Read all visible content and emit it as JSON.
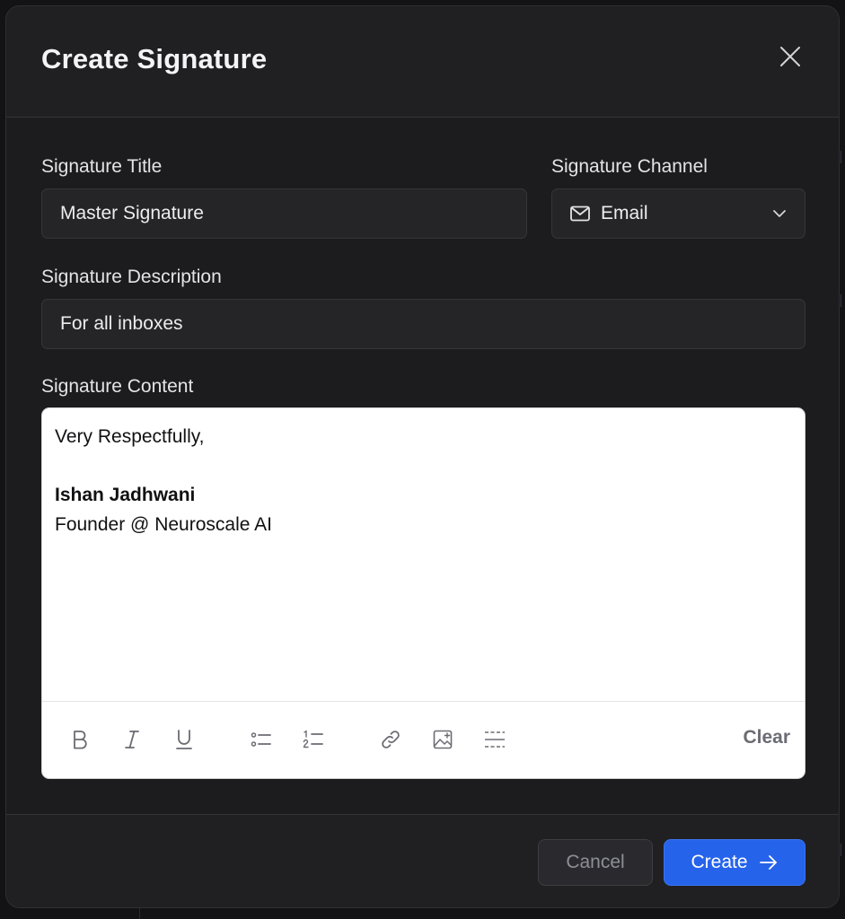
{
  "dialog": {
    "title": "Create Signature"
  },
  "form": {
    "title_label": "Signature Title",
    "title_value": "Master Signature",
    "channel_label": "Signature Channel",
    "channel_value": "Email",
    "description_label": "Signature Description",
    "description_value": "For all inboxes",
    "content_label": "Signature Content"
  },
  "editor": {
    "lines": [
      "Very Respectfully,",
      "",
      "Ishan Jadhwani",
      "Founder @ Neuroscale AI"
    ],
    "toolbar": {
      "tools": [
        "bold-icon",
        "italic-icon",
        "underline-icon",
        "bullet-list-icon",
        "numbered-list-icon",
        "link-icon",
        "image-icon",
        "divider-icon"
      ],
      "clear_label": "Clear"
    }
  },
  "footer": {
    "cancel_label": "Cancel",
    "create_label": "Create"
  },
  "colors": {
    "accent": "#2563eb",
    "surface": "#1c1c1f",
    "editor_bg": "#ffffff"
  }
}
